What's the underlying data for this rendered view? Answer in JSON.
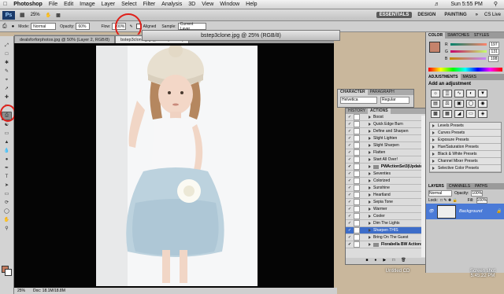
{
  "menubar": {
    "apple": "",
    "app_name": "Photoshop",
    "items": [
      "File",
      "Edit",
      "Image",
      "Layer",
      "Select",
      "Filter",
      "Analysis",
      "3D",
      "View",
      "Window",
      "Help"
    ],
    "clock": "Sun 5:55 PM",
    "account": "CS Live"
  },
  "appbar": {
    "logo": "Ps",
    "zoom": "25%",
    "workspaces": [
      "ESSENTIALS",
      "DESIGN",
      "PAINTING"
    ]
  },
  "options": {
    "mode_label": "Mode:",
    "mode_value": "Normal",
    "opacity_label": "Opacity:",
    "opacity_value": "60%",
    "flow_label": "Flow:",
    "flow_value": "100%",
    "aligned_label": "Aligned",
    "sample_label": "Sample:",
    "sample_value": "Current Layer"
  },
  "document": {
    "tab1": "dealsforforphotos.jpg @ 50% (Layer 2, RGB/8)",
    "tab2": "bstep3clone.jpg @ 25% (RGB/8)",
    "float_title": "bstep3clone.jpg @ 25% (RGB/8)",
    "status_zoom": "25%",
    "status_doc": "Doc: 18.1M/18.8M"
  },
  "character_panel": {
    "tabs": [
      "CHARACTER",
      "PARAGRAPH"
    ],
    "font": "Helvetica",
    "style": "Regular"
  },
  "actions_panel": {
    "tabs": [
      "HISTORY",
      "ACTIONS"
    ],
    "rows": [
      {
        "label": "Boost",
        "type": "action"
      },
      {
        "label": "Quick Edge Burn",
        "type": "action"
      },
      {
        "label": "Define and Sharpen",
        "type": "action"
      },
      {
        "label": "Slight Lighten",
        "type": "action"
      },
      {
        "label": "Slight Sharpen",
        "type": "action"
      },
      {
        "label": "Flatten",
        "type": "action"
      },
      {
        "label": "Start All Over!",
        "type": "action"
      },
      {
        "label": "PWActionSet3(Updated)",
        "type": "group"
      },
      {
        "label": "Seventies",
        "type": "action"
      },
      {
        "label": "Colorized",
        "type": "action"
      },
      {
        "label": "Sunshine",
        "type": "action"
      },
      {
        "label": "Heartland",
        "type": "action"
      },
      {
        "label": "Sepia Tone",
        "type": "action"
      },
      {
        "label": "Warmer",
        "type": "action"
      },
      {
        "label": "Cooler",
        "type": "action"
      },
      {
        "label": "Dim The Lights",
        "type": "action"
      },
      {
        "label": "Sharpen THIS",
        "type": "selected"
      },
      {
        "label": "Bring On The Guest",
        "type": "action"
      },
      {
        "label": "Florabella BW Actions",
        "type": "group"
      }
    ]
  },
  "color_panel": {
    "tabs": [
      "COLOR",
      "SWATCHES",
      "STYLES"
    ],
    "channels": [
      {
        "label": "R",
        "value": "197"
      },
      {
        "label": "G",
        "value": "131"
      },
      {
        "label": "B",
        "value": "108"
      }
    ],
    "foreground": "#c5836c"
  },
  "adjustments_panel": {
    "tabs": [
      "ADJUSTMENTS",
      "MASKS"
    ],
    "title": "Add an adjustment",
    "presets": [
      "Levels Presets",
      "Curves Presets",
      "Exposure Presets",
      "Hue/Saturation Presets",
      "Black & White Presets",
      "Channel Mixer Presets",
      "Selective Color Presets"
    ]
  },
  "layers_panel": {
    "tabs": [
      "LAYERS",
      "CHANNELS",
      "PATHS"
    ],
    "blend": "Normal",
    "opacity_label": "Opacity:",
    "opacity": "100%",
    "lock_label": "Lock:",
    "fill_label": "Fill:",
    "fill": "100%",
    "layer_name": "Background"
  },
  "desktop": {
    "label1": "Untitled CD",
    "label2": "Screen shot 5.45.22 PM"
  },
  "colors": {
    "selection": "#3d6dc9",
    "annotation": "#e0201a"
  }
}
